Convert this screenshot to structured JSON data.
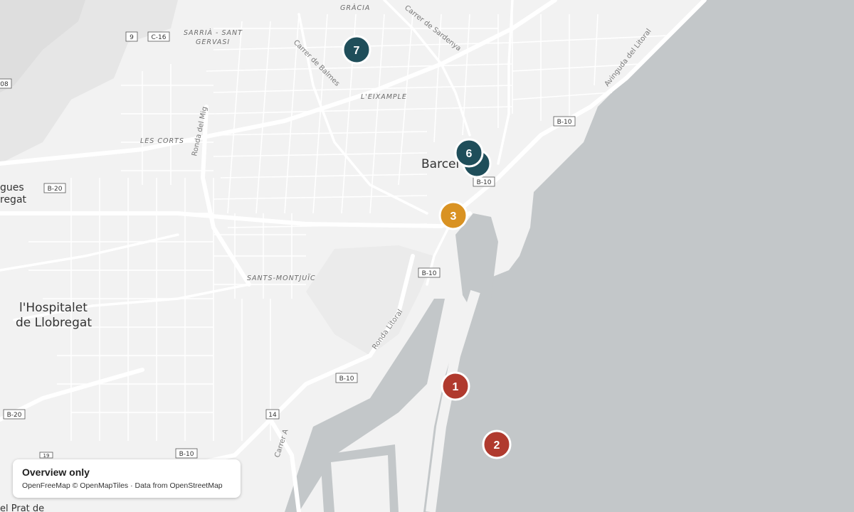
{
  "colors": {
    "land": "#f2f2f2",
    "water": "#c3c7c9",
    "hill": "#e4e4e4",
    "marker_red": "#b03a2e",
    "marker_teal": "#1f4e5a",
    "marker_orange": "#d99222"
  },
  "districts": [
    "GRÀCIA",
    "SARRIÀ - SANT",
    "GERVASI",
    "L'EIXAMPLE",
    "LES CORTS",
    "SANTS-MONTJUÏC"
  ],
  "cities": [
    "Barcel",
    "l'Hospitalet",
    "de Llobregat",
    "gues",
    "regat",
    "el Prat de"
  ],
  "streets": [
    "Carrer de Sardenya",
    "Carrer de Balmes",
    "Ronda del Mig",
    "Avinguda del Litoral",
    "Ronda Litoral",
    "Carrer A"
  ],
  "road_shields": [
    "9",
    "C-16",
    "B-20",
    "B-10",
    "B-10",
    "B-10",
    "B-10",
    "B-10",
    "B-20",
    "14",
    "B-10",
    "19",
    "08"
  ],
  "markers": [
    {
      "label": "7",
      "color": "#1f4e5a"
    },
    {
      "label": "6",
      "color": "#1f4e5a"
    },
    {
      "label": "",
      "color": "#1f4e5a"
    },
    {
      "label": "3",
      "color": "#d99222"
    },
    {
      "label": "1",
      "color": "#b03a2e"
    },
    {
      "label": "2",
      "color": "#b03a2e"
    }
  ],
  "attribution": {
    "title": "Overview only",
    "text": "OpenFreeMap © OpenMapTiles · Data from OpenStreetMap"
  }
}
